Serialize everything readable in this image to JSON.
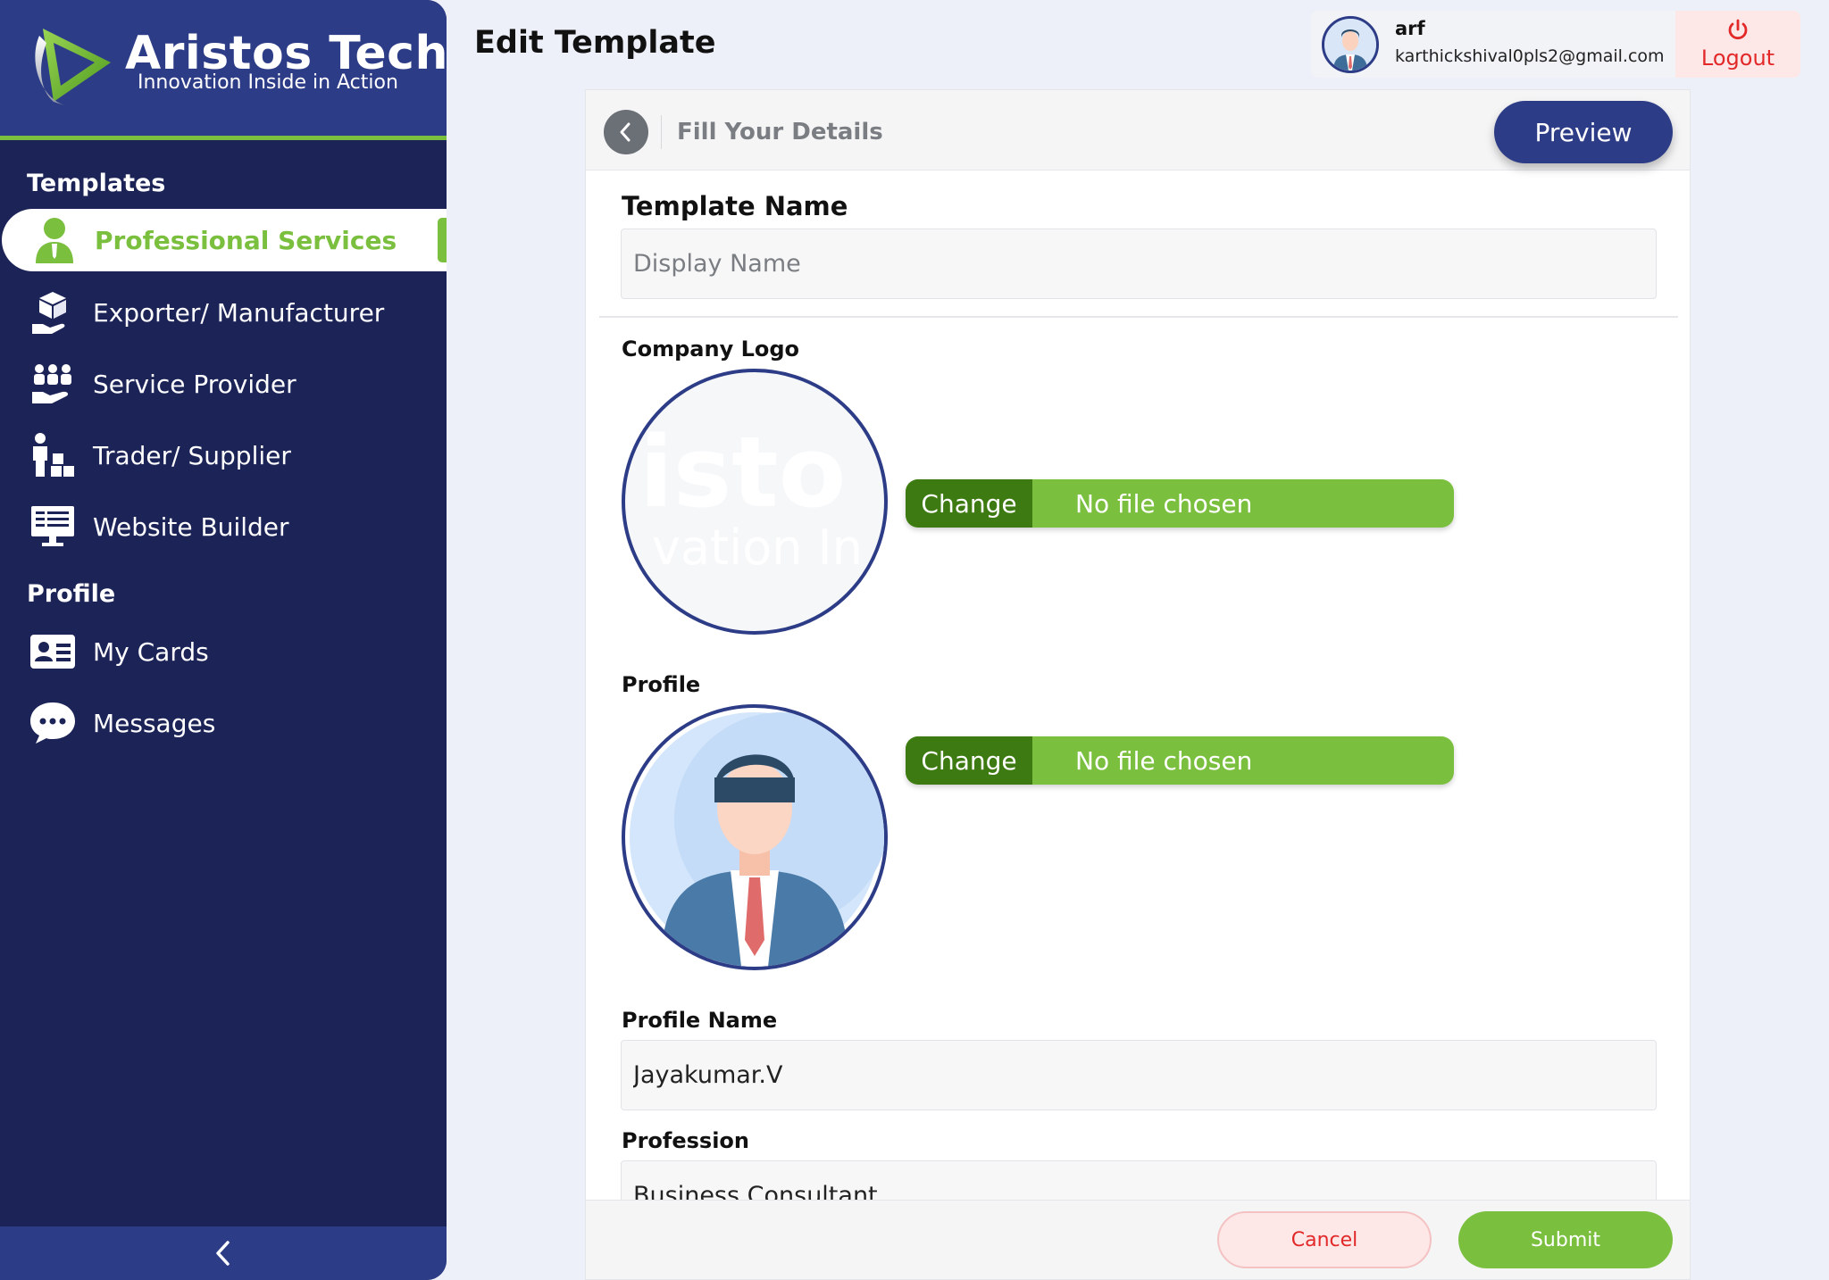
{
  "brand": {
    "name": "Aristos Tech",
    "tagline": "Innovation Inside in Action",
    "accent": "#7bbf3f",
    "primary": "#2d3c86",
    "sidebar_bg": "#1b2357"
  },
  "sidebar": {
    "templates_heading": "Templates",
    "templates": [
      {
        "label": "Professional Services",
        "icon": "user-tie-icon",
        "active": true
      },
      {
        "label": "Exporter/ Manufacturer",
        "icon": "boxes-hand-icon",
        "active": false
      },
      {
        "label": "Service Provider",
        "icon": "people-hand-icon",
        "active": false
      },
      {
        "label": "Trader/ Supplier",
        "icon": "trader-boxes-icon",
        "active": false
      },
      {
        "label": "Website Builder",
        "icon": "monitor-icon",
        "active": false
      }
    ],
    "profile_heading": "Profile",
    "profile_items": [
      {
        "label": "My Cards",
        "icon": "id-card-icon"
      },
      {
        "label": "Messages",
        "icon": "chat-bubble-icon"
      }
    ],
    "collapse_icon": "chevron-left-icon"
  },
  "header": {
    "title": "Edit Template",
    "user": {
      "name": "arf",
      "email": "karthickshival0pls2@gmail.com"
    },
    "logout_label": "Logout",
    "logout_icon": "power-icon"
  },
  "card": {
    "title": "Fill Your Details",
    "preview_label": "Preview",
    "template_name": {
      "label": "Template Name",
      "placeholder": "Display Name",
      "value": ""
    },
    "company_logo": {
      "label": "Company Logo",
      "watermark_line1": "isto",
      "watermark_line2": "vation In"
    },
    "profile": {
      "label": "Profile"
    },
    "file_picker": {
      "button_label": "Change",
      "status": "No file chosen"
    },
    "profile_name": {
      "label": "Profile Name",
      "value": "Jayakumar.V"
    },
    "profession": {
      "label": "Profession",
      "value": "Business Consultant"
    },
    "cancel_label": "Cancel",
    "submit_label": "Submit"
  }
}
